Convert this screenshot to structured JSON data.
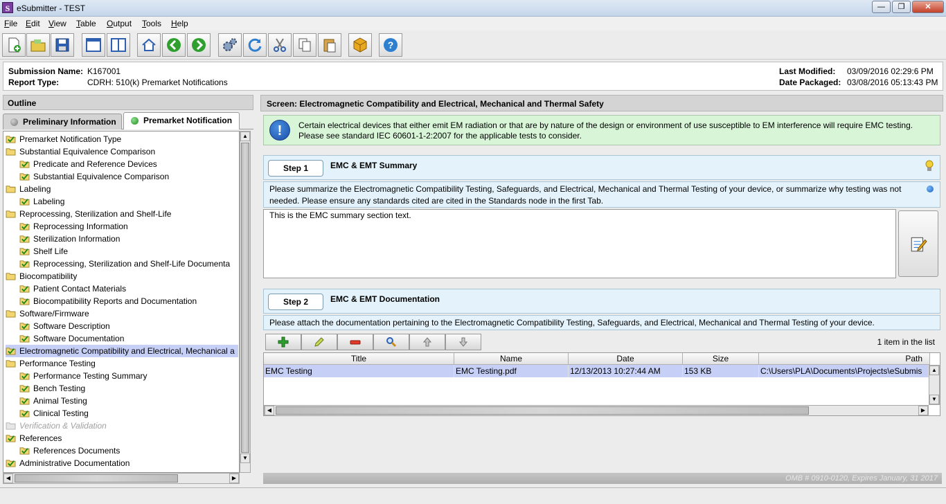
{
  "window": {
    "title": "eSubmitter - TEST",
    "app_icon": "S"
  },
  "menu": [
    "File",
    "Edit",
    "View",
    "Table",
    "Output",
    "Tools",
    "Help"
  ],
  "toolbar_icons": [
    "new-document-icon",
    "open-folder-icon",
    "save-disk-icon",
    "window-icon",
    "split-view-icon",
    "home-icon",
    "back-arrow-icon",
    "forward-arrow-icon",
    "settings-gears-icon",
    "refresh-icon",
    "cut-scissors-icon",
    "copy-icon",
    "paste-clipboard-icon",
    "package-box-icon",
    "help-icon"
  ],
  "submission": {
    "name_label": "Submission Name:",
    "name": "K167001",
    "type_label": "Report Type:",
    "type": "CDRH: 510(k) Premarket Notifications",
    "modified_label": "Last Modified:",
    "modified": "03/09/2016 02:29:6 PM",
    "packaged_label": "Date Packaged:",
    "packaged": "03/08/2016 05:13:43 PM"
  },
  "outline": {
    "header": "Outline",
    "tabs": [
      {
        "label": "Preliminary Information",
        "status_color": "#8a8a8a"
      },
      {
        "label": "Premarket Notification",
        "status_color": "#2fa02f"
      }
    ],
    "items": [
      {
        "label": "Premarket Notification Type",
        "icon": "checked-folder-icon"
      },
      {
        "label": "Substantial Equivalence Comparison",
        "icon": "folder-icon"
      },
      {
        "label": "Predicate and Reference Devices",
        "icon": "checked-folder-icon"
      },
      {
        "label": "Substantial Equivalence Comparison",
        "icon": "checked-folder-icon"
      },
      {
        "label": "Labeling",
        "icon": "folder-icon"
      },
      {
        "label": "Labeling",
        "icon": "checked-folder-icon"
      },
      {
        "label": "Reprocessing, Sterilization and Shelf-Life",
        "icon": "folder-icon"
      },
      {
        "label": "Reprocessing Information",
        "icon": "checked-folder-icon"
      },
      {
        "label": "Sterilization Information",
        "icon": "checked-folder-icon"
      },
      {
        "label": "Shelf Life",
        "icon": "checked-folder-icon"
      },
      {
        "label": "Reprocessing, Sterilization and Shelf-Life Documenta",
        "icon": "checked-folder-icon"
      },
      {
        "label": "Biocompatibility",
        "icon": "folder-icon"
      },
      {
        "label": "Patient Contact Materials",
        "icon": "checked-folder-icon"
      },
      {
        "label": "Biocompatibility Reports and Documentation",
        "icon": "checked-folder-icon"
      },
      {
        "label": "Software/Firmware",
        "icon": "folder-icon"
      },
      {
        "label": "Software Description",
        "icon": "checked-folder-icon"
      },
      {
        "label": "Software Documentation",
        "icon": "checked-folder-icon"
      },
      {
        "label": "Electromagnetic Compatibility and Electrical, Mechanical a",
        "icon": "checked-folder-icon",
        "selected": true
      },
      {
        "label": "Performance Testing",
        "icon": "folder-icon"
      },
      {
        "label": "Performance Testing Summary",
        "icon": "checked-folder-icon"
      },
      {
        "label": "Bench Testing",
        "icon": "checked-folder-icon"
      },
      {
        "label": "Animal Testing",
        "icon": "checked-folder-icon"
      },
      {
        "label": "Clinical Testing",
        "icon": "checked-folder-icon"
      },
      {
        "label": "Verification & Validation",
        "icon": "disabled-folder-icon",
        "disabled": true
      },
      {
        "label": "References",
        "icon": "checked-folder-icon"
      },
      {
        "label": "References Documents",
        "icon": "checked-folder-icon"
      },
      {
        "label": "Administrative Documentation",
        "icon": "checked-folder-icon"
      }
    ]
  },
  "screen": {
    "header": "Screen: Electromagnetic Compatibility and Electrical, Mechanical and Thermal Safety",
    "notice_icon": "!",
    "notice": "Certain electrical devices that either emit EM radiation or that are by nature of the design or environment of use susceptible to EM interference will require EMC testing. Please see standard IEC 60601-1-2:2007 for the applicable tests to consider.",
    "step1": {
      "label": "Step 1",
      "title": "EMC & EMT Summary",
      "description": "Please summarize the Electromagnetic Compatibility Testing, Safeguards, and Electrical, Mechanical and Thermal Testing of your device, or summarize why testing was not needed.  Please ensure any standards cited are cited in the Standards node in the first Tab.",
      "text": "This is the EMC summary section text."
    },
    "step2": {
      "label": "Step 2",
      "title": "EMC & EMT Documentation",
      "description": "Please attach the documentation pertaining to the Electromagnetic Compatibility Testing, Safeguards, and Electrical, Mechanical and Thermal Testing of your device.",
      "count": "1 item in the list",
      "columns": [
        "Title",
        "Name",
        "Date",
        "Size",
        "Path"
      ],
      "rows": [
        {
          "title": "EMC Testing",
          "name": "EMC Testing.pdf",
          "date": "12/13/2013 10:27:44 AM",
          "size": "153 KB",
          "path": "C:\\Users\\PLA\\Documents\\Projects\\eSubmis"
        }
      ]
    },
    "footer": "OMB # 0910-0120, Expires January, 31 2017"
  }
}
